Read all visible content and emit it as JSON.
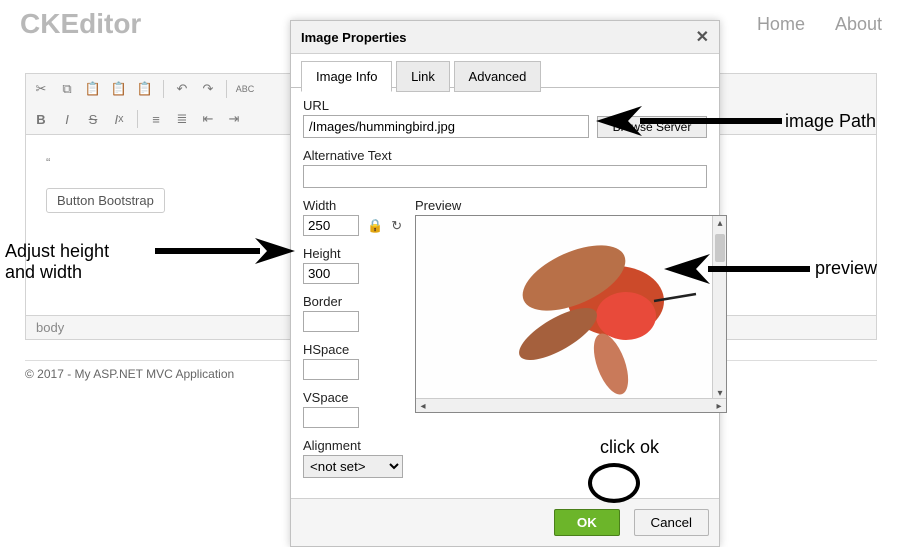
{
  "header": {
    "logo": "CKEditor",
    "nav_home": "Home",
    "nav_about": "About"
  },
  "editor": {
    "button_bootstrap": "Button Bootstrap",
    "status": "body"
  },
  "footer": {
    "copyright": "© 2017 - My ASP.NET MVC Application"
  },
  "dialog": {
    "title": "Image Properties",
    "tabs": {
      "info": "Image Info",
      "link": "Link",
      "advanced": "Advanced"
    },
    "url_label": "URL",
    "url_value": "/Images/hummingbird.jpg",
    "browse": "Browse Server",
    "alt_label": "Alternative Text",
    "alt_value": "",
    "width_label": "Width",
    "width_value": "250",
    "height_label": "Height",
    "height_value": "300",
    "border_label": "Border",
    "border_value": "",
    "hspace_label": "HSpace",
    "hspace_value": "",
    "vspace_label": "VSpace",
    "vspace_value": "",
    "align_label": "Alignment",
    "align_value": "<not set>",
    "preview_label": "Preview",
    "ok": "OK",
    "cancel": "Cancel"
  },
  "annotations": {
    "image_path": "image Path",
    "adjust": "Adjust height",
    "and_width": "and width",
    "preview": "preview",
    "click_ok": "click ok"
  }
}
